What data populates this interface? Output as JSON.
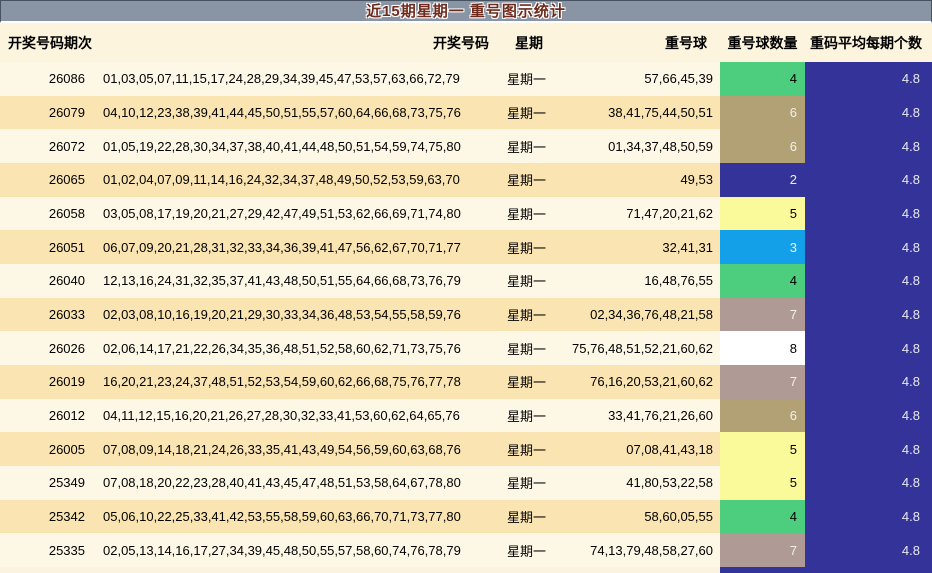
{
  "title": "近15期星期一 重号图示统计",
  "columns": {
    "period": "开奖号码期次",
    "numbers": "开奖号码",
    "week": "星期",
    "repeat_balls": "重号球",
    "repeat_count": "重号球数量",
    "avg_per_period": "重码平均每期个数"
  },
  "colors": {
    "title_bar_bg": "#8995A4",
    "title_text": "#6E2A1C",
    "header_bg": "#FCF4DD",
    "row_odd": "#FDF7E6",
    "row_even": "#FAE5B2",
    "avg_col_bg": "#333399",
    "avg_col_text": "#E9E9F2",
    "count_palette": {
      "2": "#333399",
      "3": "#14A0E8",
      "4": "#4DCE7E",
      "5": "#FAFA9B",
      "6": "#B2A175",
      "7": "#B09A96",
      "8": "#FFFFFF"
    },
    "count_text_dark": "#000000",
    "count_text_light": "#F2F0EC",
    "count_text_is_light_for": [
      "2",
      "3",
      "6",
      "7"
    ],
    "partial_row_count_bg": "#333399"
  },
  "rows": [
    {
      "period": "26086",
      "numbers": "01,03,05,07,11,15,17,24,28,29,34,39,45,47,53,57,63,66,72,79",
      "week": "星期一",
      "repeat": "57,66,45,39",
      "count": "4",
      "avg": "4.8"
    },
    {
      "period": "26079",
      "numbers": "04,10,12,23,38,39,41,44,45,50,51,55,57,60,64,66,68,73,75,76",
      "week": "星期一",
      "repeat": "38,41,75,44,50,51",
      "count": "6",
      "avg": "4.8"
    },
    {
      "period": "26072",
      "numbers": "01,05,19,22,28,30,34,37,38,40,41,44,48,50,51,54,59,74,75,80",
      "week": "星期一",
      "repeat": "01,34,37,48,50,59",
      "count": "6",
      "avg": "4.8"
    },
    {
      "period": "26065",
      "numbers": "01,02,04,07,09,11,14,16,24,32,34,37,48,49,50,52,53,59,63,70",
      "week": "星期一",
      "repeat": "49,53",
      "count": "2",
      "avg": "4.8"
    },
    {
      "period": "26058",
      "numbers": "03,05,08,17,19,20,21,27,29,42,47,49,51,53,62,66,69,71,74,80",
      "week": "星期一",
      "repeat": "71,47,20,21,62",
      "count": "5",
      "avg": "4.8"
    },
    {
      "period": "26051",
      "numbers": "06,07,09,20,21,28,31,32,33,34,36,39,41,47,56,62,67,70,71,77",
      "week": "星期一",
      "repeat": "32,41,31",
      "count": "3",
      "avg": "4.8"
    },
    {
      "period": "26040",
      "numbers": "12,13,16,24,31,32,35,37,41,43,48,50,51,55,64,66,68,73,76,79",
      "week": "星期一",
      "repeat": "16,48,76,55",
      "count": "4",
      "avg": "4.8"
    },
    {
      "period": "26033",
      "numbers": "02,03,08,10,16,19,20,21,29,30,33,34,36,48,53,54,55,58,59,76",
      "week": "星期一",
      "repeat": "02,34,36,76,48,21,58",
      "count": "7",
      "avg": "4.8"
    },
    {
      "period": "26026",
      "numbers": "02,06,14,17,21,22,26,34,35,36,48,51,52,58,60,62,71,73,75,76",
      "week": "星期一",
      "repeat": "75,76,48,51,52,21,60,62",
      "count": "8",
      "avg": "4.8"
    },
    {
      "period": "26019",
      "numbers": "16,20,21,23,24,37,48,51,52,53,54,59,60,62,66,68,75,76,77,78",
      "week": "星期一",
      "repeat": "76,16,20,53,21,60,62",
      "count": "7",
      "avg": "4.8"
    },
    {
      "period": "26012",
      "numbers": "04,11,12,15,16,20,21,26,27,28,30,32,33,41,53,60,62,64,65,76",
      "week": "星期一",
      "repeat": "33,41,76,21,26,60",
      "count": "6",
      "avg": "4.8"
    },
    {
      "period": "26005",
      "numbers": "07,08,09,14,18,21,24,26,33,35,41,43,49,54,56,59,60,63,68,76",
      "week": "星期一",
      "repeat": "07,08,41,43,18",
      "count": "5",
      "avg": "4.8"
    },
    {
      "period": "25349",
      "numbers": "07,08,18,20,22,23,28,40,41,43,45,47,48,51,53,58,64,67,78,80",
      "week": "星期一",
      "repeat": "41,80,53,22,58",
      "count": "5",
      "avg": "4.8"
    },
    {
      "period": "25342",
      "numbers": "05,06,10,22,25,33,41,42,53,55,58,59,60,63,66,70,71,73,77,80",
      "week": "星期一",
      "repeat": "58,60,05,55",
      "count": "4",
      "avg": "4.8"
    },
    {
      "period": "25335",
      "numbers": "02,05,13,14,16,17,27,34,39,45,48,50,55,57,58,60,74,76,78,79",
      "week": "星期一",
      "repeat": "74,13,79,48,58,27,60",
      "count": "7",
      "avg": "4.8"
    }
  ]
}
